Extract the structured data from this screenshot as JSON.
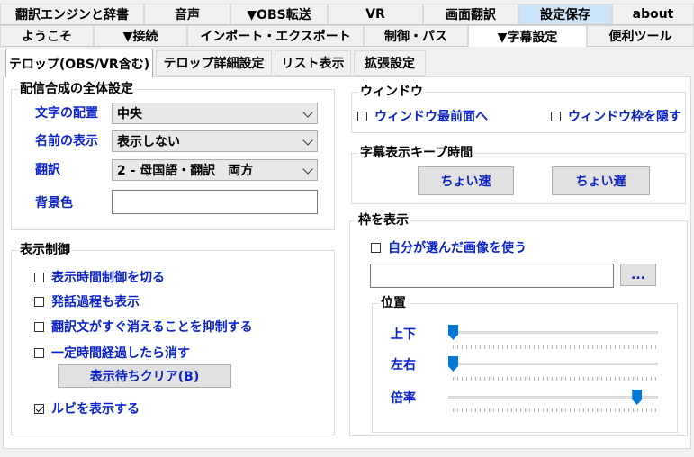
{
  "tabs_row1": [
    "翻訳エンジンと辞書",
    "音声",
    "▼OBS転送",
    "VR",
    "画面翻訳",
    "設定保存",
    "about"
  ],
  "tabs_row2": [
    "ようこそ",
    "▼接続",
    "インポート・エクスポート",
    "制御・パス",
    "▼字幕設定",
    "便利ツール"
  ],
  "subtabs": [
    "テロップ(OBS/VR含む)",
    "テロップ詳細設定",
    "リスト表示",
    "拡張設定"
  ],
  "compose": {
    "title": "配信合成の全体設定",
    "position_label": "文字の配置",
    "position_value": "中央",
    "name_label": "名前の表示",
    "name_value": "表示しない",
    "translate_label": "翻訳",
    "translate_value": "2 - 母国語・翻訳　両方",
    "bg_label": "背景色",
    "bg_value": ""
  },
  "display": {
    "title": "表示制御",
    "cb1": "表示時間制御を切る",
    "cb2": "発話過程も表示",
    "cb3": "翻訳文がすぐ消えることを抑制する",
    "cb4": "一定時間経過したら消す",
    "clear_button": "表示待ちクリア(B)",
    "cb5": "ルビを表示する",
    "cb5_checked": true
  },
  "window": {
    "title": "ウィンドウ",
    "topmost": "ウィンドウ最前面へ",
    "hide_frame": "ウィンドウ枠を隠す"
  },
  "keep": {
    "title": "字幕表示キープ時間",
    "faster": "ちょい速",
    "slower": "ちょい遅"
  },
  "frame": {
    "title": "枠を表示",
    "use_image": "自分が選んだ画像を使う",
    "path_value": "",
    "browse": "...",
    "position_title": "位置",
    "updown": "上下",
    "leftright": "左右",
    "scale": "倍率",
    "updown_level": 0.0,
    "leftright_level": 0.0,
    "scale_level": 0.92
  }
}
